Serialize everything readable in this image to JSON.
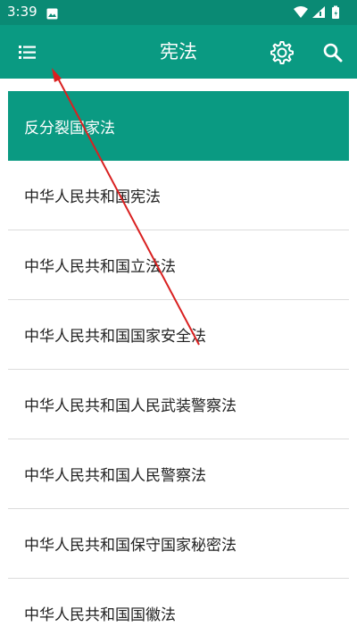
{
  "status_bar": {
    "time": "3:39",
    "icons": [
      "image-icon",
      "wifi-icon",
      "signal-icon",
      "battery-icon"
    ]
  },
  "app_bar": {
    "title": "宪法",
    "menu_icon": "menu-icon",
    "settings_icon": "gear-icon",
    "search_icon": "search-icon"
  },
  "list": {
    "items": [
      {
        "label": "反分裂国家法",
        "selected": true
      },
      {
        "label": "中华人民共和国宪法",
        "selected": false
      },
      {
        "label": "中华人民共和国立法法",
        "selected": false
      },
      {
        "label": "中华人民共和国国家安全法",
        "selected": false
      },
      {
        "label": "中华人民共和国人民武装警察法",
        "selected": false
      },
      {
        "label": "中华人民共和国人民警察法",
        "selected": false
      },
      {
        "label": "中华人民共和国保守国家秘密法",
        "selected": false
      },
      {
        "label": "中华人民共和国国徽法",
        "selected": false
      }
    ]
  },
  "colors": {
    "status_bar": "#0a8a74",
    "app_bar": "#0a9a82",
    "selected_item": "#0a9a82",
    "annotation_arrow": "#d92020"
  }
}
